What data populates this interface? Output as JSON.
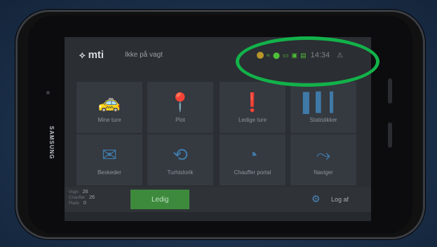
{
  "app": {
    "logo_text": "mti",
    "duty_status": "Ikke på vagt",
    "clock": "14:34"
  },
  "tiles": [
    {
      "label": "Mine ture",
      "icon": "taxi-icon"
    },
    {
      "label": "Plot",
      "icon": "map-pin-icon"
    },
    {
      "label": "Ledige ture",
      "icon": "exclamation-icon"
    },
    {
      "label": "Statistikker",
      "icon": "bar-chart-icon"
    },
    {
      "label": "Beskeder",
      "icon": "envelope-icon"
    },
    {
      "label": "Turhistorik",
      "icon": "history-icon"
    },
    {
      "label": "Chauffer portal",
      "icon": "speedometer-icon"
    },
    {
      "label": "Naviger",
      "icon": "route-icon"
    }
  ],
  "bottom": {
    "stats": [
      {
        "label": "Vogn",
        "value": "26"
      },
      {
        "label": "Chauffør",
        "value": "26"
      },
      {
        "label": "Plads",
        "value": "0"
      }
    ],
    "status_button": "Ledig",
    "logoff": "Log af"
  },
  "colors": {
    "highlight_oval": "#12b24a",
    "accent_blue": "#3f79a6",
    "ledig_green": "#3d8a3d"
  }
}
